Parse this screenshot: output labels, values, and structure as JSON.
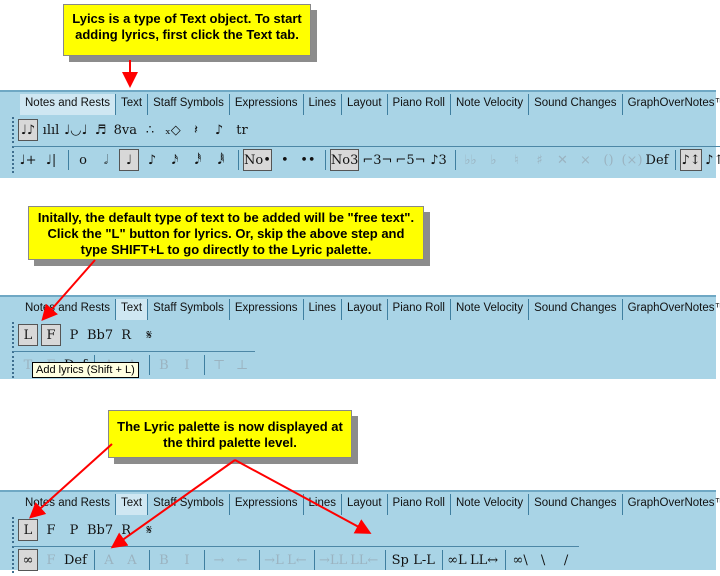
{
  "callouts": [
    "Lyics is a type of Text object. To start adding lyrics, first click the Text tab.",
    "Initally, the default type of text to be added will be \"free text\". Click the \"L\" button for lyrics.  Or, skip the above step and type SHIFT+L to go directly to the Lyric palette.",
    "The Lyric palette is now displayed at the third palette level."
  ],
  "tabs": [
    "Notes and Rests",
    "Text",
    "Staff Symbols",
    "Expressions",
    "Lines",
    "Layout",
    "Piano Roll",
    "Note Velocity",
    "Sound Changes",
    "GraphOverNotes™"
  ],
  "panels": [
    {
      "active_tab": 0,
      "rows": [
        [
          [
            "notes-icon",
            "♩♪",
            1
          ],
          [
            "velocity-bars-icon",
            "ılıl"
          ],
          [
            "tie-icon",
            "♩◡♩"
          ],
          [
            "beam-icon",
            "♬"
          ],
          [
            "octave-icon",
            "8va"
          ],
          [
            "ornament-icon",
            "∴"
          ],
          [
            "cross-note-icon",
            "ₓ◇"
          ],
          [
            "rest-icon",
            "𝄽"
          ],
          [
            "grace-note-icon",
            "♪"
          ],
          [
            "trill-icon",
            "tr"
          ]
        ],
        [
          [
            "insert-note-icon",
            "♩+"
          ],
          [
            "delete-note-icon",
            "♩|"
          ],
          [
            "div"
          ],
          [
            "whole-note-icon",
            "o"
          ],
          [
            "half-note-icon",
            "𝅗𝅥"
          ],
          [
            "quarter-note-icon",
            "♩",
            1
          ],
          [
            "eighth-note-icon",
            "♪"
          ],
          [
            "sixteenth-note-icon",
            "𝅘𝅥𝅯"
          ],
          [
            "thirtysecond-note-icon",
            "𝅘𝅥𝅰"
          ],
          [
            "sixtyfourth-note-icon",
            "𝅘𝅥𝅱"
          ],
          [
            "div"
          ],
          [
            "no-dot-icon",
            "No•",
            1
          ],
          [
            "dot-icon",
            "•"
          ],
          [
            "double-dot-icon",
            "••"
          ],
          [
            "div"
          ],
          [
            "no-tuplet-icon",
            "No3",
            1
          ],
          [
            "triplet-icon",
            "⌐3¬"
          ],
          [
            "quintuplet-icon",
            "⌐5¬"
          ],
          [
            "tuplet-custom-icon",
            "♪3"
          ],
          [
            "div"
          ],
          [
            "double-flat-icon",
            "♭♭",
            2
          ],
          [
            "flat-icon",
            "♭",
            2
          ],
          [
            "natural-icon",
            "♮",
            2
          ],
          [
            "sharp-icon",
            "♯",
            2
          ],
          [
            "double-sharp-icon",
            "✕",
            2
          ],
          [
            "remove-accidental-icon",
            "×",
            2
          ],
          [
            "parentheses-icon",
            "()",
            2
          ],
          [
            "remove-parentheses-icon",
            "(×)",
            2
          ],
          [
            "default-icon",
            "Def"
          ],
          [
            "div"
          ],
          [
            "stem-auto-icon",
            "♪↕",
            1
          ],
          [
            "stem-up-icon",
            "♪↑"
          ],
          [
            "stem-down-icon",
            "♪↓"
          ]
        ]
      ]
    },
    {
      "active_tab": 1,
      "tooltip": "Add lyrics (Shift + L)",
      "rows": [
        [
          [
            "lyrics-button",
            "L",
            1
          ],
          [
            "free-text-button",
            "F",
            1
          ],
          [
            "page-text-icon",
            "P"
          ],
          [
            "chord-symbol-icon",
            "Bb7"
          ],
          [
            "rehearsal-mark-icon",
            "R"
          ],
          [
            "segno-icon",
            "𝄋"
          ]
        ],
        [
          [
            "text-style-icon",
            "T",
            2
          ],
          [
            "italic-f-icon",
            "F",
            2
          ],
          [
            "default-icon",
            "Def"
          ],
          [
            "div"
          ],
          [
            "large-a-icon",
            "A",
            2
          ],
          [
            "small-a-icon",
            "A",
            2
          ],
          [
            "div"
          ],
          [
            "bold-icon",
            "B",
            2
          ],
          [
            "italic-icon",
            "I",
            2
          ],
          [
            "div"
          ],
          [
            "align-top-icon",
            "⊤",
            2
          ],
          [
            "align-bottom-icon",
            "⊥",
            2
          ]
        ]
      ]
    },
    {
      "active_tab": 1,
      "rows": [
        [
          [
            "lyrics-button",
            "L",
            1
          ],
          [
            "free-text-button",
            "F"
          ],
          [
            "page-text-icon",
            "P"
          ],
          [
            "chord-symbol-icon",
            "Bb7"
          ],
          [
            "rehearsal-mark-icon",
            "R"
          ],
          [
            "segno-icon",
            "𝄋"
          ]
        ],
        [
          [
            "glasses-icon",
            "∞",
            1
          ],
          [
            "italic-f-icon",
            "F",
            2
          ],
          [
            "default-icon",
            "Def"
          ],
          [
            "div"
          ],
          [
            "large-a-icon",
            "A",
            2
          ],
          [
            "small-a-icon",
            "A",
            2
          ],
          [
            "div"
          ],
          [
            "bold-icon",
            "B",
            2
          ],
          [
            "italic-icon",
            "I",
            2
          ],
          [
            "div"
          ],
          [
            "arrow-right-icon",
            "→",
            2
          ],
          [
            "arrow-left-icon",
            "←",
            2
          ],
          [
            "div"
          ],
          [
            "lyric-shift-right-icon",
            "→L",
            2
          ],
          [
            "lyric-shift-left-icon",
            "L←",
            2
          ],
          [
            "div"
          ],
          [
            "lyric-shift-right-multi-icon",
            "→LL",
            2
          ],
          [
            "lyric-shift-left-multi-icon",
            "LL←",
            2
          ],
          [
            "div"
          ],
          [
            "spacing-icon",
            "Sp"
          ],
          [
            "hyphen-icon",
            "L-L"
          ],
          [
            "div"
          ],
          [
            "glasses-l-icon",
            "∞L"
          ],
          [
            "lyric-spacing-icon",
            "LL↔"
          ],
          [
            "div"
          ],
          [
            "glasses-slash-icon",
            "∞\\"
          ],
          [
            "backslash-icon",
            "\\"
          ],
          [
            "slash-icon",
            "/"
          ]
        ]
      ]
    }
  ],
  "colors": {
    "callout": "#ffff00",
    "arrow": "#ff0000",
    "toolbar": "#a9d4e6"
  }
}
